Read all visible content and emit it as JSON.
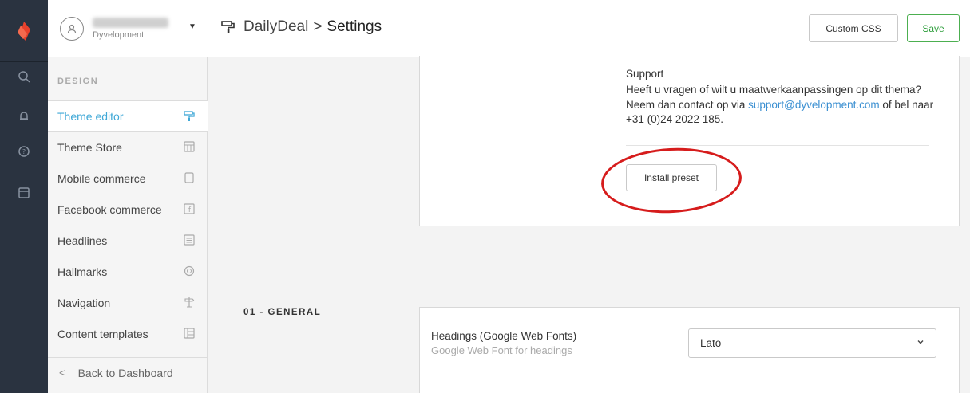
{
  "account": {
    "name_placeholder": "",
    "shop": "Dyvelopment"
  },
  "sidebar": {
    "section": "DESIGN",
    "items": [
      {
        "label": "Theme editor"
      },
      {
        "label": "Theme Store"
      },
      {
        "label": "Mobile commerce"
      },
      {
        "label": "Facebook commerce"
      },
      {
        "label": "Headlines"
      },
      {
        "label": "Hallmarks"
      },
      {
        "label": "Navigation"
      },
      {
        "label": "Content templates"
      }
    ],
    "back": "Back to Dashboard"
  },
  "header": {
    "app": "DailyDeal",
    "separator": ">",
    "page": "Settings",
    "custom_css_label": "Custom CSS",
    "save_label": "Save"
  },
  "support": {
    "title": "Support",
    "text_before": "Heeft u vragen of wilt u maatwerkaanpassingen op dit thema? Neem dan contact op via ",
    "email": "support@dyvelopment.com",
    "text_after": " of bel naar +31 (0)24 2022 185.",
    "install_label": "Install preset"
  },
  "general": {
    "section": "01 - GENERAL",
    "field_label": "Headings (Google Web Fonts)",
    "field_help": "Google Web Font for headings",
    "selected": "Lato"
  },
  "colors": {
    "rail": "#2a3340",
    "accent": "#3fa8d7",
    "save": "#2e9e3c",
    "annotation": "#d61c1c",
    "logo": "#e8412c"
  }
}
